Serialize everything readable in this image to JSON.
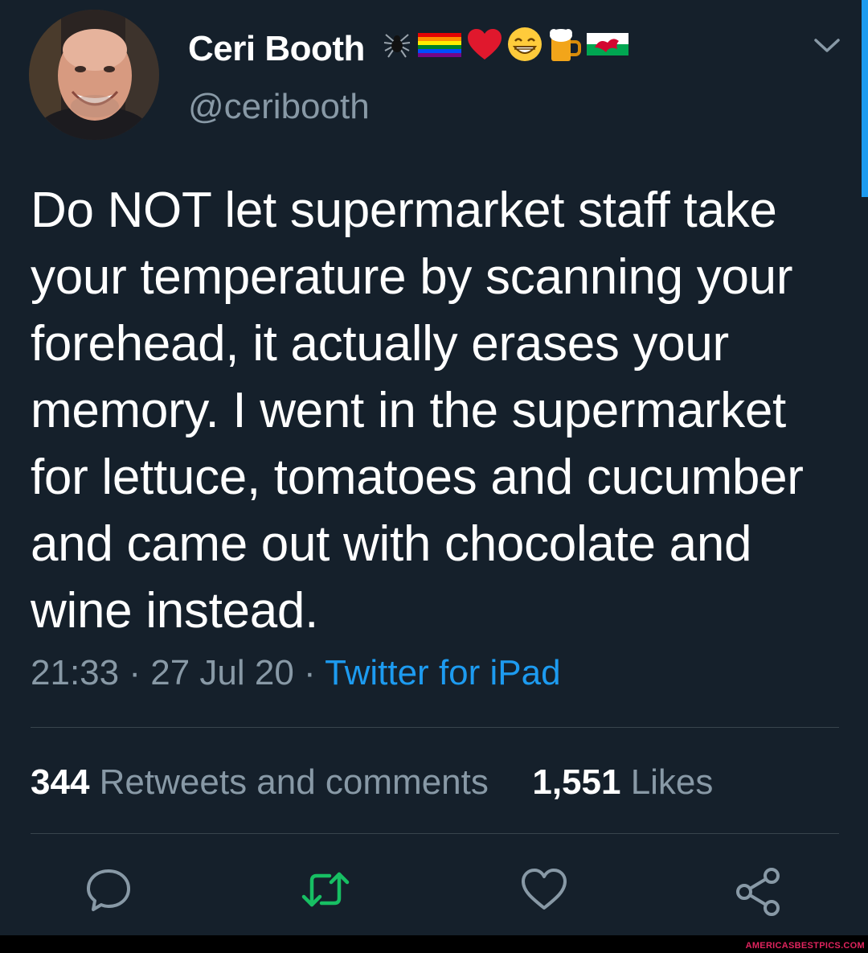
{
  "author": {
    "display_name": "Ceri Booth",
    "handle": "@ceribooth",
    "name_emojis": [
      "spider-icon",
      "rainbow-flag-icon",
      "heart-icon",
      "grin-icon",
      "beer-icon",
      "wales-flag-icon"
    ]
  },
  "tweet": {
    "text": "Do NOT let supermarket staff take your temperature by scanning your forehead, it actually erases your memory. I went in the supermarket for lettuce, tomatoes and cucumber and came out with chocolate and wine instead.",
    "time": "21:33",
    "date": "27 Jul 20",
    "separator": "·",
    "source": "Twitter for iPad"
  },
  "stats": {
    "retweets_count": "344",
    "retweets_label": "Retweets and comments",
    "likes_count": "1,551",
    "likes_label": "Likes"
  },
  "actions": [
    "reply-icon",
    "retweet-icon",
    "like-icon",
    "share-icon"
  ],
  "watermark": "AMERICASBESTPICS.COM",
  "colors": {
    "background": "#15202b",
    "accent": "#1d9bf0",
    "muted": "#8899a6",
    "retweet": "#17bf63",
    "divider": "#38444d"
  }
}
